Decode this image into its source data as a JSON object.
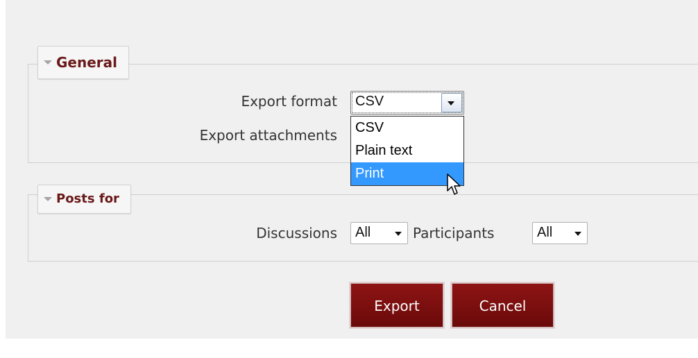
{
  "general": {
    "legend": "General",
    "export_format_label": "Export format",
    "export_format_value": "CSV",
    "export_attachments_label": "Export attachments",
    "export_format_options": [
      "CSV",
      "Plain text",
      "Print"
    ],
    "highlighted_option": "Print"
  },
  "posts": {
    "legend": "Posts for",
    "discussions_label": "Discussions",
    "discussions_value": "All",
    "participants_label": "Participants",
    "participants_value": "All"
  },
  "actions": {
    "export_label": "Export",
    "cancel_label": "Cancel"
  },
  "colors": {
    "legend_text": "#6a1818",
    "button_bg": "#7a0f0f",
    "highlight": "#3399ff"
  }
}
